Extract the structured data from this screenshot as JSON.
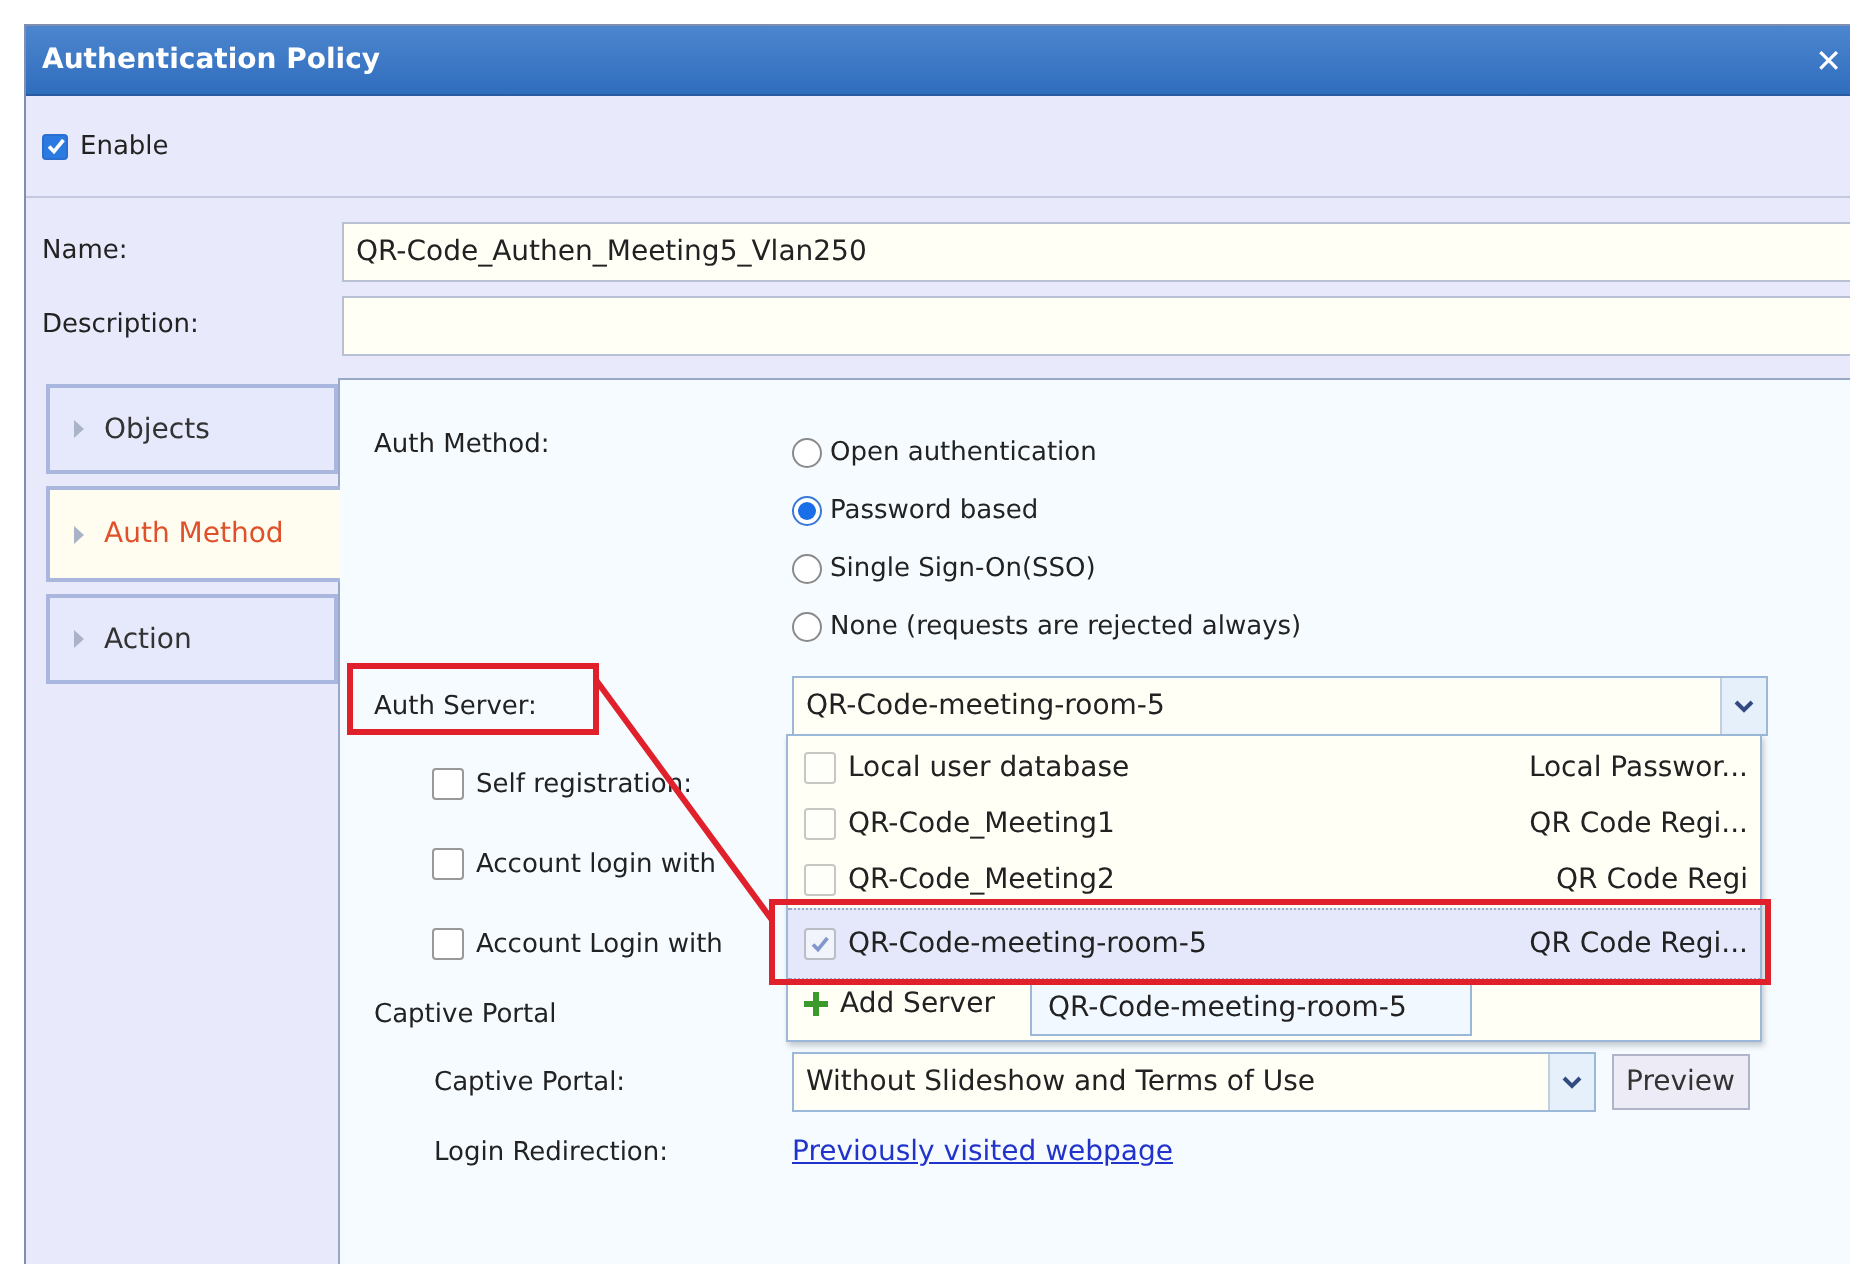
{
  "window": {
    "title": "Authentication Policy",
    "close": "✕"
  },
  "enable": {
    "label": "Enable",
    "checked": true
  },
  "fields": [
    {
      "label": "Name:",
      "value": "QR-Code_Authen_Meeting5_Vlan250"
    },
    {
      "label": "Description:"
    }
  ],
  "nav": [
    {
      "label": "Objects",
      "selected": false
    },
    {
      "label": "Auth Method",
      "selected": true
    },
    {
      "label": "Action",
      "selected": false
    }
  ],
  "auth_method": {
    "label": "Auth Method:",
    "options": [
      {
        "label": "Open authentication",
        "selected": false
      },
      {
        "label": "Password based",
        "selected": true
      },
      {
        "label": "Single Sign-On(SSO)",
        "selected": false
      },
      {
        "label": "None (requests are rejected always)",
        "selected": false
      }
    ]
  },
  "auth_server": {
    "label": "Auth Server:",
    "value": "QR-Code-meeting-room-5",
    "options": [
      {
        "name": "Local user database",
        "type": "Local Passwor...",
        "checked": false,
        "selected": false
      },
      {
        "name": "QR-Code_Meeting1",
        "type": "QR Code Regi...",
        "checked": false,
        "selected": false
      },
      {
        "name": "QR-Code_Meeting2",
        "type": "QR Code Regi",
        "checked": false,
        "selected": false
      },
      {
        "name": "QR-Code-meeting-room-5",
        "type": "QR Code Regi...",
        "checked": true,
        "selected": true
      }
    ],
    "add_server": "Add Server",
    "tooltip": "QR-Code-meeting-room-5"
  },
  "checkboxes": [
    {
      "label": "Self registration:",
      "checked": false
    },
    {
      "label": "Account login with",
      "checked": false
    },
    {
      "label": "Account Login with",
      "checked": false
    }
  ],
  "captive_portal": {
    "heading": "Captive Portal",
    "portal_label": "Captive Portal:",
    "portal_value": "Without Slideshow and Terms of Use",
    "preview": "Preview",
    "redirect_label": "Login Redirection:",
    "redirect_link": "Previously visited webpage"
  }
}
